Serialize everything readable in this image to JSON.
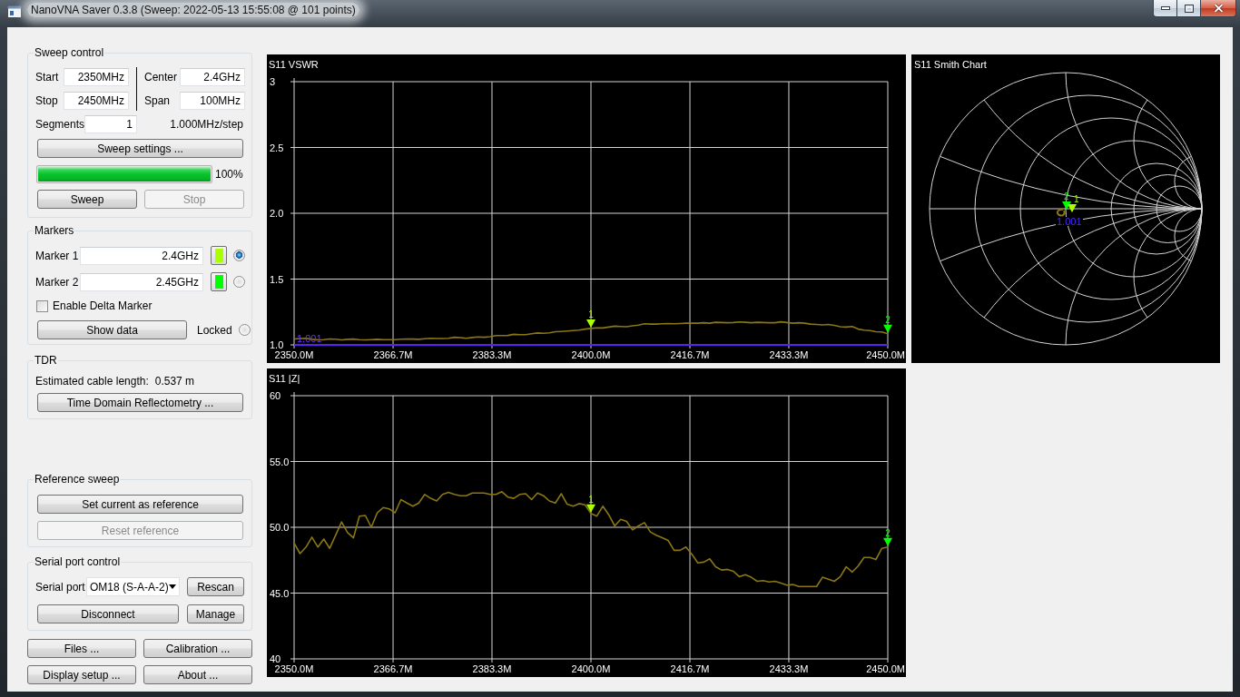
{
  "window": {
    "title": "NanoVNA Saver 0.3.8 (Sweep: 2022-05-13 15:55:08 @ 101 points)"
  },
  "sweep_control": {
    "title": "Sweep control",
    "fields": [
      {
        "label": "Start",
        "value": "2350MHz"
      },
      {
        "label": "Stop",
        "value": "2450MHz"
      },
      {
        "label": "Center",
        "value": "2.4GHz"
      },
      {
        "label": "Span",
        "value": "100MHz"
      }
    ],
    "segments": {
      "label": "Segments",
      "value": "1"
    },
    "step": "1.000MHz/step",
    "settings_button": "Sweep settings ...",
    "progress": {
      "level": 1,
      "reading": "100%"
    },
    "buttons": [
      {
        "label": "Sweep",
        "disabled": false
      },
      {
        "label": "Stop",
        "disabled": true
      }
    ]
  },
  "markers": {
    "title": "Markers",
    "items": [
      {
        "label": "Marker 1",
        "value": "2.4GHz",
        "color": "#aaff00",
        "selected": true
      },
      {
        "label": "Marker 2",
        "value": "2.45GHz",
        "color": "#00ff00",
        "selected": false
      }
    ],
    "delta": {
      "label": "Enable Delta Marker",
      "checked": false
    },
    "show_data_button": "Show data",
    "locked": {
      "label": "Locked",
      "checked": false
    }
  },
  "tdr": {
    "title": "TDR",
    "label": "Estimated cable length:",
    "value": "0.537 m",
    "button": "Time Domain Reflectometry ..."
  },
  "reference_sweep": {
    "title": "Reference sweep",
    "buttons": [
      {
        "label": "Set current as reference",
        "disabled": false
      },
      {
        "label": "Reset reference",
        "disabled": true
      }
    ]
  },
  "serial_port": {
    "title": "Serial port control",
    "label": "Serial port",
    "port": "OM18 (S-A-A-2)",
    "buttons": [
      "Rescan",
      "Disconnect",
      "Manage"
    ]
  },
  "bottom_buttons": [
    "Files ...",
    "Calibration ...",
    "Display setup ...",
    "About ..."
  ],
  "vswr_chart": {
    "vswr_marker": {
      "label": "1.001"
    },
    "chart_data": {
      "type": "line",
      "title": "S11 VSWR",
      "x": [
        2350,
        2351,
        2352,
        2353,
        2354,
        2355,
        2356,
        2357,
        2358,
        2359,
        2360,
        2361,
        2362,
        2363,
        2364,
        2365,
        2366,
        2367,
        2368,
        2369,
        2370,
        2371,
        2372,
        2373,
        2374,
        2375,
        2376,
        2377,
        2378,
        2379,
        2380,
        2381,
        2382,
        2383,
        2384,
        2385,
        2386,
        2387,
        2388,
        2389,
        2390,
        2391,
        2392,
        2393,
        2394,
        2395,
        2396,
        2397,
        2398,
        2399,
        2400,
        2401,
        2402,
        2403,
        2404,
        2405,
        2406,
        2407,
        2408,
        2409,
        2410,
        2411,
        2412,
        2413,
        2414,
        2415,
        2416,
        2417,
        2418,
        2419,
        2420,
        2421,
        2422,
        2423,
        2424,
        2425,
        2426,
        2427,
        2428,
        2429,
        2430,
        2431,
        2432,
        2433,
        2434,
        2435,
        2436,
        2437,
        2438,
        2439,
        2440,
        2441,
        2442,
        2443,
        2444,
        2445,
        2446,
        2447,
        2448,
        2449,
        2450
      ],
      "values": [
        1.045,
        1.048,
        1.05,
        1.042,
        1.038,
        1.04,
        1.045,
        1.043,
        1.038,
        1.042,
        1.044,
        1.04,
        1.038,
        1.04,
        1.042,
        1.04,
        1.04,
        1.04,
        1.043,
        1.045,
        1.044,
        1.042,
        1.046,
        1.05,
        1.048,
        1.048,
        1.05,
        1.058,
        1.055,
        1.05,
        1.056,
        1.06,
        1.058,
        1.062,
        1.07,
        1.07,
        1.072,
        1.08,
        1.078,
        1.078,
        1.085,
        1.09,
        1.088,
        1.092,
        1.1,
        1.102,
        1.105,
        1.108,
        1.112,
        1.12,
        1.125,
        1.13,
        1.128,
        1.135,
        1.142,
        1.14,
        1.138,
        1.145,
        1.15,
        1.16,
        1.158,
        1.158,
        1.16,
        1.162,
        1.16,
        1.162,
        1.165,
        1.165,
        1.165,
        1.168,
        1.165,
        1.172,
        1.17,
        1.168,
        1.17,
        1.174,
        1.172,
        1.168,
        1.172,
        1.17,
        1.168,
        1.168,
        1.175,
        1.17,
        1.165,
        1.168,
        1.165,
        1.158,
        1.155,
        1.152,
        1.155,
        1.148,
        1.138,
        1.135,
        1.14,
        1.12,
        1.112,
        1.108,
        1.1,
        1.098,
        1.085
      ],
      "xlim": [
        2350,
        2450
      ],
      "ylim": [
        1,
        3
      ],
      "xticks": [
        {
          "value": 2350,
          "label": "2350.0M"
        },
        {
          "value": 2366.67,
          "label": "2366.7M"
        },
        {
          "value": 2383.33,
          "label": "2383.3M"
        },
        {
          "value": 2400,
          "label": "2400.0M"
        },
        {
          "value": 2416.67,
          "label": "2416.7M"
        },
        {
          "value": 2433.33,
          "label": "2433.3M"
        },
        {
          "value": 2450,
          "label": "2450.0M"
        }
      ],
      "yticks": [
        3,
        2.5,
        {
          "value": 2,
          "label": "2.0"
        },
        1.5,
        {
          "value": 1,
          "label": "1.0"
        }
      ],
      "grid": true,
      "annotations": [
        {
          "x": 2400,
          "y": 1.125,
          "text": "1"
        },
        {
          "x": 2450,
          "y": 1.085,
          "text": "2"
        }
      ]
    }
  },
  "smith_chart": {
    "title": "S11 Smith Chart",
    "vswr_label": "1.001",
    "markers": [
      {
        "label": "2",
        "color": "#00ff00"
      },
      {
        "label": "1",
        "color": "#aaff00"
      }
    ]
  },
  "impedance_chart": {
    "chart_data": {
      "type": "line",
      "title": "S11 |Z|",
      "x": [
        2350,
        2351,
        2352,
        2353,
        2354,
        2355,
        2356,
        2357,
        2358,
        2359,
        2360,
        2361,
        2362,
        2363,
        2364,
        2365,
        2366,
        2367,
        2368,
        2369,
        2370,
        2371,
        2372,
        2373,
        2374,
        2375,
        2376,
        2377,
        2378,
        2379,
        2380,
        2381,
        2382,
        2383,
        2384,
        2385,
        2386,
        2387,
        2388,
        2389,
        2390,
        2391,
        2392,
        2393,
        2394,
        2395,
        2396,
        2397,
        2398,
        2399,
        2400,
        2401,
        2402,
        2403,
        2404,
        2405,
        2406,
        2407,
        2408,
        2409,
        2410,
        2411,
        2412,
        2413,
        2414,
        2415,
        2416,
        2417,
        2418,
        2419,
        2420,
        2421,
        2422,
        2423,
        2424,
        2425,
        2426,
        2427,
        2428,
        2429,
        2430,
        2431,
        2432,
        2433,
        2434,
        2435,
        2436,
        2437,
        2438,
        2439,
        2440,
        2441,
        2442,
        2443,
        2444,
        2445,
        2446,
        2447,
        2448,
        2449,
        2450
      ],
      "values": [
        48.8,
        48.0,
        48.5,
        49.25,
        48.5,
        49.1,
        48.4,
        49.4,
        50.4,
        49.6,
        49.2,
        50.85,
        50.9,
        50.0,
        51.1,
        51.5,
        51.4,
        51.1,
        52.1,
        51.85,
        51.6,
        51.85,
        52.5,
        52.2,
        52.0,
        52.5,
        52.65,
        52.5,
        52.4,
        52.4,
        52.6,
        52.6,
        52.6,
        52.5,
        52.5,
        52.7,
        52.3,
        52.2,
        52.5,
        52.55,
        52.1,
        52.6,
        52.4,
        52.0,
        51.85,
        52.55,
        51.75,
        51.6,
        51.8,
        51.7,
        51.05,
        50.85,
        51.6,
        50.95,
        50.1,
        50.6,
        50.45,
        49.8,
        50.1,
        50.35,
        49.65,
        49.4,
        49.2,
        49.0,
        48.25,
        48.25,
        48.5,
        47.95,
        47.3,
        47.35,
        47.6,
        47.0,
        46.75,
        46.8,
        46.65,
        46.25,
        46.4,
        46.2,
        45.9,
        45.95,
        45.85,
        45.9,
        45.75,
        45.6,
        45.65,
        45.5,
        45.5,
        45.5,
        45.5,
        46.2,
        46.05,
        45.9,
        46.25,
        47.0,
        46.6,
        47.05,
        47.7,
        47.7,
        47.55,
        48.4,
        48.5
      ],
      "xlim": [
        2350,
        2450
      ],
      "ylim": [
        40,
        60
      ],
      "xticks": [
        {
          "value": 2350,
          "label": "2350.0M"
        },
        {
          "value": 2366.67,
          "label": "2366.7M"
        },
        {
          "value": 2383.33,
          "label": "2383.3M"
        },
        {
          "value": 2400,
          "label": "2400.0M"
        },
        {
          "value": 2416.67,
          "label": "2416.7M"
        },
        {
          "value": 2433.33,
          "label": "2433.3M"
        },
        {
          "value": 2450,
          "label": "2450.0M"
        }
      ],
      "yticks": [
        60,
        {
          "value": 55,
          "label": "55.0"
        },
        {
          "value": 50,
          "label": "50.0"
        },
        {
          "value": 45,
          "label": "45.0"
        },
        40
      ],
      "grid": true,
      "annotations": [
        {
          "x": 2400,
          "y": 51.05,
          "text": "1"
        },
        {
          "x": 2450,
          "y": 48.5,
          "text": "2"
        }
      ]
    }
  }
}
